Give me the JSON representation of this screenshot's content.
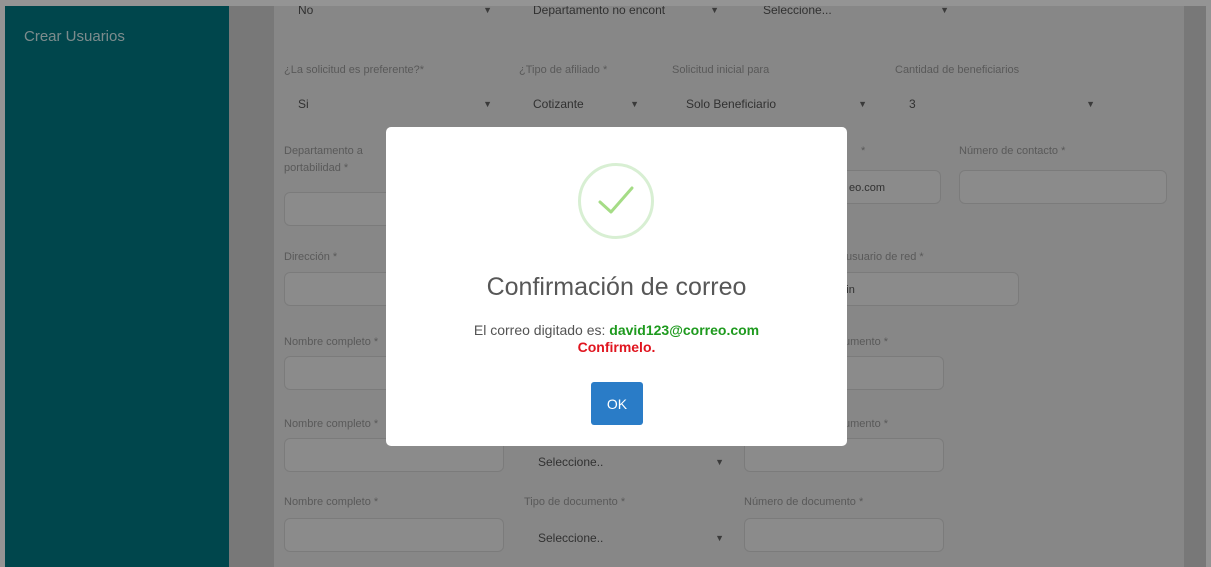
{
  "sidebar": {
    "items": [
      {
        "label": "Crear Usuarios"
      }
    ]
  },
  "form": {
    "row0": {
      "select1": "No",
      "select2": "Departamento no encont",
      "select3": "Seleccione..."
    },
    "row1": {
      "labels": [
        "¿La solicitud es preferente?*",
        "¿Tipo de afiliado *",
        "Solicitud inicial para",
        "Cantidad de beneficiarios"
      ],
      "values": [
        "Si",
        "Cotizante",
        "Solo Beneficiario",
        "3"
      ]
    },
    "row2": {
      "label_left_line1": "Departamento a",
      "label_left_line2": "portabilidad *",
      "label_mid_tail": "*",
      "email_partial": "eo.com",
      "label_contact": "Número de contacto *"
    },
    "row3": {
      "label_left": "Dirección *",
      "label_right": "usuario de red *",
      "value_right": "dmin"
    },
    "row4": {
      "label_left": "Nombre completo *",
      "label_right": "umento *"
    },
    "row5": {
      "label_left": "Nombre completo *",
      "label_right": "umento *",
      "select_value": "Seleccione.."
    },
    "row6": {
      "label_left": "Nombre completo *",
      "label_mid": "Tipo de documento *",
      "label_right": "Número de documento *",
      "select_value": "Seleccione.."
    }
  },
  "modal": {
    "title": "Confirmación de correo",
    "body_prefix": "El correo digitado es:",
    "email": "david123@correo.com",
    "confirm_text": "Confirmelo.",
    "ok_label": "OK",
    "accent_color": "#a5dc86"
  }
}
